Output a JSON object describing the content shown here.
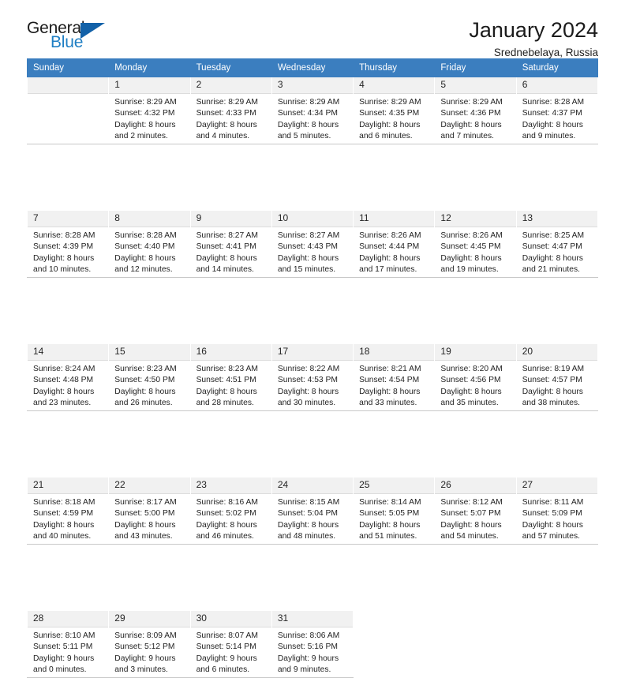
{
  "brand": {
    "name_top": "General",
    "name_bottom": "Blue",
    "triangle_color": "#1261a8",
    "blue_text_color": "#1f7fc4"
  },
  "header": {
    "title": "January 2024",
    "location": "Srednebelaya, Russia"
  },
  "theme": {
    "header_bg": "#3b7ebf",
    "header_text": "#ffffff",
    "daynum_bg": "#f1f1f1",
    "grid_line": "#c8c8c8"
  },
  "weekday_headers": [
    "Sunday",
    "Monday",
    "Tuesday",
    "Wednesday",
    "Thursday",
    "Friday",
    "Saturday"
  ],
  "weeks": [
    [
      {
        "day": "",
        "blank": true
      },
      {
        "day": "1",
        "sunrise": "Sunrise: 8:29 AM",
        "sunset": "Sunset: 4:32 PM",
        "daylight_1": "Daylight: 8 hours",
        "daylight_2": "and 2 minutes."
      },
      {
        "day": "2",
        "sunrise": "Sunrise: 8:29 AM",
        "sunset": "Sunset: 4:33 PM",
        "daylight_1": "Daylight: 8 hours",
        "daylight_2": "and 4 minutes."
      },
      {
        "day": "3",
        "sunrise": "Sunrise: 8:29 AM",
        "sunset": "Sunset: 4:34 PM",
        "daylight_1": "Daylight: 8 hours",
        "daylight_2": "and 5 minutes."
      },
      {
        "day": "4",
        "sunrise": "Sunrise: 8:29 AM",
        "sunset": "Sunset: 4:35 PM",
        "daylight_1": "Daylight: 8 hours",
        "daylight_2": "and 6 minutes."
      },
      {
        "day": "5",
        "sunrise": "Sunrise: 8:29 AM",
        "sunset": "Sunset: 4:36 PM",
        "daylight_1": "Daylight: 8 hours",
        "daylight_2": "and 7 minutes."
      },
      {
        "day": "6",
        "sunrise": "Sunrise: 8:28 AM",
        "sunset": "Sunset: 4:37 PM",
        "daylight_1": "Daylight: 8 hours",
        "daylight_2": "and 9 minutes."
      }
    ],
    [
      {
        "day": "7",
        "sunrise": "Sunrise: 8:28 AM",
        "sunset": "Sunset: 4:39 PM",
        "daylight_1": "Daylight: 8 hours",
        "daylight_2": "and 10 minutes."
      },
      {
        "day": "8",
        "sunrise": "Sunrise: 8:28 AM",
        "sunset": "Sunset: 4:40 PM",
        "daylight_1": "Daylight: 8 hours",
        "daylight_2": "and 12 minutes."
      },
      {
        "day": "9",
        "sunrise": "Sunrise: 8:27 AM",
        "sunset": "Sunset: 4:41 PM",
        "daylight_1": "Daylight: 8 hours",
        "daylight_2": "and 14 minutes."
      },
      {
        "day": "10",
        "sunrise": "Sunrise: 8:27 AM",
        "sunset": "Sunset: 4:43 PM",
        "daylight_1": "Daylight: 8 hours",
        "daylight_2": "and 15 minutes."
      },
      {
        "day": "11",
        "sunrise": "Sunrise: 8:26 AM",
        "sunset": "Sunset: 4:44 PM",
        "daylight_1": "Daylight: 8 hours",
        "daylight_2": "and 17 minutes."
      },
      {
        "day": "12",
        "sunrise": "Sunrise: 8:26 AM",
        "sunset": "Sunset: 4:45 PM",
        "daylight_1": "Daylight: 8 hours",
        "daylight_2": "and 19 minutes."
      },
      {
        "day": "13",
        "sunrise": "Sunrise: 8:25 AM",
        "sunset": "Sunset: 4:47 PM",
        "daylight_1": "Daylight: 8 hours",
        "daylight_2": "and 21 minutes."
      }
    ],
    [
      {
        "day": "14",
        "sunrise": "Sunrise: 8:24 AM",
        "sunset": "Sunset: 4:48 PM",
        "daylight_1": "Daylight: 8 hours",
        "daylight_2": "and 23 minutes."
      },
      {
        "day": "15",
        "sunrise": "Sunrise: 8:23 AM",
        "sunset": "Sunset: 4:50 PM",
        "daylight_1": "Daylight: 8 hours",
        "daylight_2": "and 26 minutes."
      },
      {
        "day": "16",
        "sunrise": "Sunrise: 8:23 AM",
        "sunset": "Sunset: 4:51 PM",
        "daylight_1": "Daylight: 8 hours",
        "daylight_2": "and 28 minutes."
      },
      {
        "day": "17",
        "sunrise": "Sunrise: 8:22 AM",
        "sunset": "Sunset: 4:53 PM",
        "daylight_1": "Daylight: 8 hours",
        "daylight_2": "and 30 minutes."
      },
      {
        "day": "18",
        "sunrise": "Sunrise: 8:21 AM",
        "sunset": "Sunset: 4:54 PM",
        "daylight_1": "Daylight: 8 hours",
        "daylight_2": "and 33 minutes."
      },
      {
        "day": "19",
        "sunrise": "Sunrise: 8:20 AM",
        "sunset": "Sunset: 4:56 PM",
        "daylight_1": "Daylight: 8 hours",
        "daylight_2": "and 35 minutes."
      },
      {
        "day": "20",
        "sunrise": "Sunrise: 8:19 AM",
        "sunset": "Sunset: 4:57 PM",
        "daylight_1": "Daylight: 8 hours",
        "daylight_2": "and 38 minutes."
      }
    ],
    [
      {
        "day": "21",
        "sunrise": "Sunrise: 8:18 AM",
        "sunset": "Sunset: 4:59 PM",
        "daylight_1": "Daylight: 8 hours",
        "daylight_2": "and 40 minutes."
      },
      {
        "day": "22",
        "sunrise": "Sunrise: 8:17 AM",
        "sunset": "Sunset: 5:00 PM",
        "daylight_1": "Daylight: 8 hours",
        "daylight_2": "and 43 minutes."
      },
      {
        "day": "23",
        "sunrise": "Sunrise: 8:16 AM",
        "sunset": "Sunset: 5:02 PM",
        "daylight_1": "Daylight: 8 hours",
        "daylight_2": "and 46 minutes."
      },
      {
        "day": "24",
        "sunrise": "Sunrise: 8:15 AM",
        "sunset": "Sunset: 5:04 PM",
        "daylight_1": "Daylight: 8 hours",
        "daylight_2": "and 48 minutes."
      },
      {
        "day": "25",
        "sunrise": "Sunrise: 8:14 AM",
        "sunset": "Sunset: 5:05 PM",
        "daylight_1": "Daylight: 8 hours",
        "daylight_2": "and 51 minutes."
      },
      {
        "day": "26",
        "sunrise": "Sunrise: 8:12 AM",
        "sunset": "Sunset: 5:07 PM",
        "daylight_1": "Daylight: 8 hours",
        "daylight_2": "and 54 minutes."
      },
      {
        "day": "27",
        "sunrise": "Sunrise: 8:11 AM",
        "sunset": "Sunset: 5:09 PM",
        "daylight_1": "Daylight: 8 hours",
        "daylight_2": "and 57 minutes."
      }
    ],
    [
      {
        "day": "28",
        "sunrise": "Sunrise: 8:10 AM",
        "sunset": "Sunset: 5:11 PM",
        "daylight_1": "Daylight: 9 hours",
        "daylight_2": "and 0 minutes."
      },
      {
        "day": "29",
        "sunrise": "Sunrise: 8:09 AM",
        "sunset": "Sunset: 5:12 PM",
        "daylight_1": "Daylight: 9 hours",
        "daylight_2": "and 3 minutes."
      },
      {
        "day": "30",
        "sunrise": "Sunrise: 8:07 AM",
        "sunset": "Sunset: 5:14 PM",
        "daylight_1": "Daylight: 9 hours",
        "daylight_2": "and 6 minutes."
      },
      {
        "day": "31",
        "sunrise": "Sunrise: 8:06 AM",
        "sunset": "Sunset: 5:16 PM",
        "daylight_1": "Daylight: 9 hours",
        "daylight_2": "and 9 minutes."
      },
      {
        "day": "",
        "empty": true
      },
      {
        "day": "",
        "empty": true
      },
      {
        "day": "",
        "empty": true
      }
    ]
  ]
}
